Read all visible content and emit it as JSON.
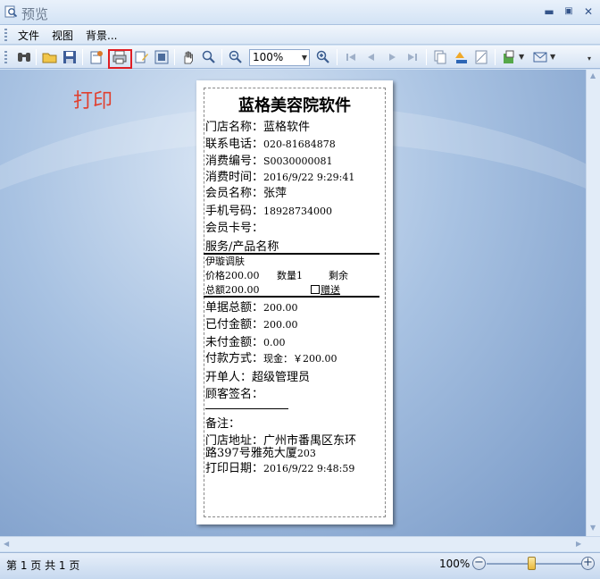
{
  "window": {
    "title": "预览"
  },
  "menu": {
    "items": [
      "文件",
      "视图",
      "背景..."
    ]
  },
  "toolbar": {
    "zoom_value": "100%"
  },
  "annotation": "打印",
  "receipt": {
    "title": "蓝格美容院软件",
    "store_name_label": "门店名称：",
    "store_name": "蓝格软件",
    "phone_label": "联系电话：",
    "phone": "020-81684878",
    "consume_no_label": "消费编号：",
    "consume_no": "S0030000081",
    "consume_time_label": "消费时间：",
    "consume_time": "2016/9/22 9:29:41",
    "member_name_label": "会员名称：",
    "member_name": "张萍",
    "mobile_label": "手机号码：",
    "mobile": "18928734000",
    "card_label": "会员卡号：",
    "product_header": "服务/产品名称",
    "item_name": "伊璇调肤",
    "price_text": "价格200.00",
    "qty_text": "数量1",
    "remain_text": "剩余",
    "total_text": "总额200.00",
    "gift_text": "赠送",
    "bill_total_label": "单据总额：",
    "bill_total": "200.00",
    "paid_label": "已付金额：",
    "paid": "200.00",
    "unpaid_label": "未付金额：",
    "unpaid": "0.00",
    "pay_method_label": "付款方式：",
    "pay_method": "现金：￥200.00",
    "operator_label": "开单人：",
    "operator": "超级管理员",
    "signature_label": "顾客签名：",
    "remarks_label": "备注：",
    "address_label": "门店地址：",
    "address_line1": "广州市番禺区东环",
    "address_line2a": "路397号雅苑大厦",
    "address_line2b": "203",
    "print_date_label": "打印日期：",
    "print_date": "2016/9/22 9:48:59"
  },
  "status": {
    "pages": "第 1 页 共 1 页",
    "zoom": "100%",
    "zoom_level_percent": 100
  }
}
